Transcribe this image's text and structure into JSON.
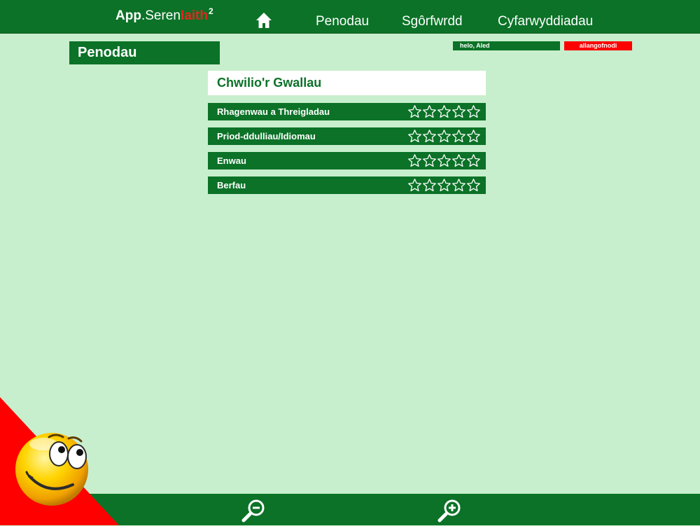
{
  "header": {
    "brand": {
      "app": "App",
      "dot": ".",
      "seren": "Seren",
      "iaith": "Iaith",
      "sup": "2"
    },
    "home_icon": "home-icon",
    "nav": [
      {
        "label": "Penodau"
      },
      {
        "label": "Sgôrfwrdd"
      },
      {
        "label": "Cyfarwyddiadau"
      }
    ]
  },
  "page": {
    "title": "Penodau",
    "greeting": "helo, Aled",
    "logout_label": "allangofnodi"
  },
  "section": {
    "title": "Chwilio'r Gwallau",
    "chapters": [
      {
        "label": "Rhagenwau a Threigladau",
        "stars": 0,
        "max_stars": 5
      },
      {
        "label": "Priod-ddulliau/Idiomau",
        "stars": 0,
        "max_stars": 5
      },
      {
        "label": "Enwau",
        "stars": 0,
        "max_stars": 5
      },
      {
        "label": "Berfau",
        "stars": 0,
        "max_stars": 5
      }
    ]
  },
  "footer": {
    "zoom_out_icon": "zoom-out-icon",
    "zoom_in_icon": "zoom-in-icon"
  },
  "colors": {
    "primary_green": "#0b7227",
    "background": "#c8efcd",
    "accent_red": "#ff0000",
    "brand_red": "#e8241d"
  }
}
